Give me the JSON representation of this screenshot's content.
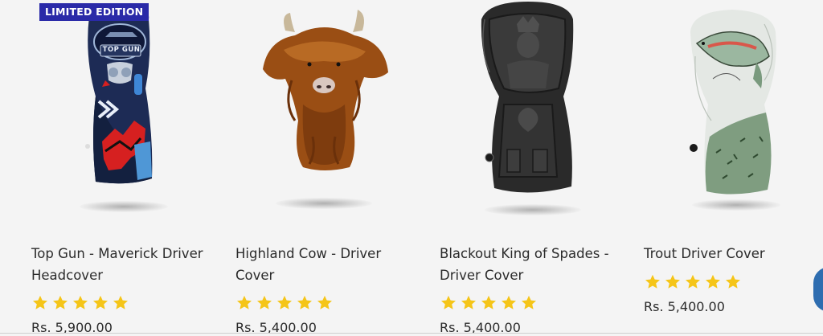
{
  "badge": {
    "label": "LIMITED EDITION"
  },
  "products": [
    {
      "title_line1": "Top Gun - Maverick Driver",
      "title_line2": "Headcover",
      "price": "Rs. 5,900.00",
      "rating": 5
    },
    {
      "title_line1": "Highland Cow - Driver",
      "title_line2": "Cover",
      "price": "Rs. 5,400.00",
      "rating": 5
    },
    {
      "title_line1": "Blackout King of Spades -",
      "title_line2": "Driver Cover",
      "price": "Rs. 5,400.00",
      "rating": 5
    },
    {
      "title_line1": "Trout Driver Cover",
      "title_line2": "",
      "price": "Rs. 5,400.00",
      "rating": 5
    }
  ],
  "headcover_texts": {
    "topgun_logo": "TOP GUN"
  },
  "colors": {
    "star": "#f5c518",
    "badge_bg": "#2a2aa8",
    "chat_button": "#2e6db0"
  },
  "icons": {
    "rating": "star-icon",
    "chat": "chat-icon"
  }
}
